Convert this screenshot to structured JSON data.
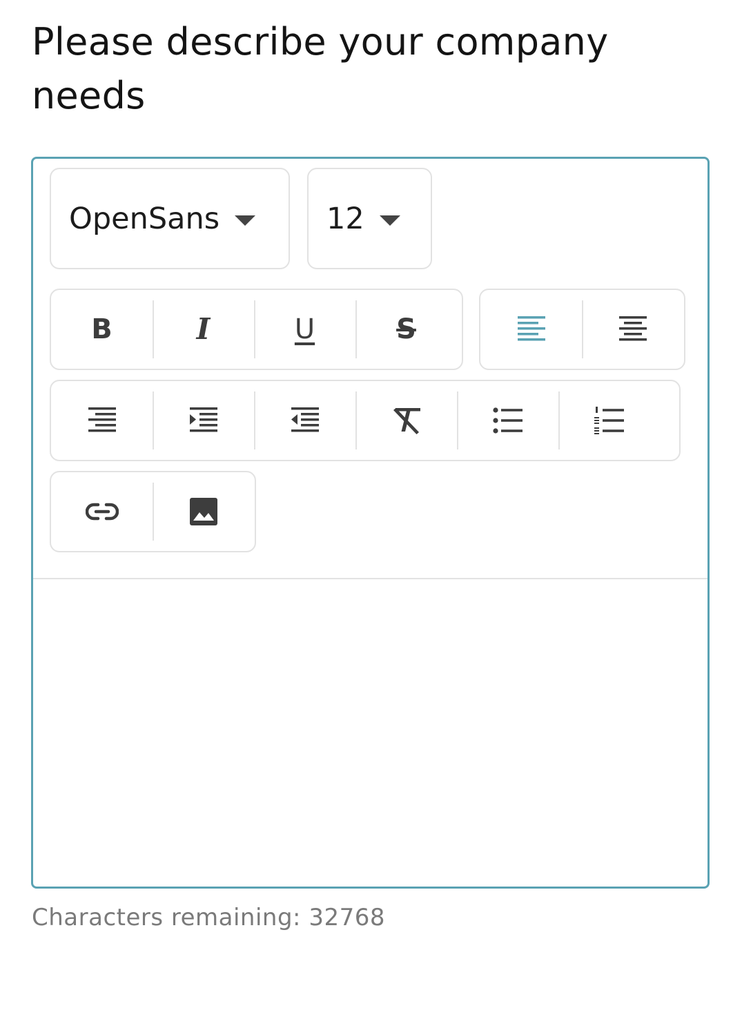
{
  "question": {
    "title": "Please describe your company needs"
  },
  "editor": {
    "font_select": {
      "value": "OpenSans",
      "icon": "caret-down-icon"
    },
    "size_select": {
      "value": "12",
      "icon": "caret-down-icon"
    },
    "text_format_group": [
      {
        "name": "bold",
        "glyph": "B"
      },
      {
        "name": "italic",
        "glyph": "I"
      },
      {
        "name": "underline",
        "glyph": "U"
      },
      {
        "name": "strikethrough",
        "glyph": "S"
      }
    ],
    "align_group": [
      {
        "name": "align-left-icon",
        "active": true
      },
      {
        "name": "align-center-icon",
        "active": false
      }
    ],
    "list_group": [
      "align-right-icon",
      "indent-increase-icon",
      "indent-decrease-icon",
      "clear-format-icon",
      "bulleted-list-icon",
      "numbered-list-icon"
    ],
    "insert_group": [
      "link-icon",
      "image-icon"
    ],
    "active_color": "#5aa2b3",
    "border_color": "#5aa2b3"
  },
  "footer": {
    "characters_remaining": "Characters remaining: 32768"
  }
}
